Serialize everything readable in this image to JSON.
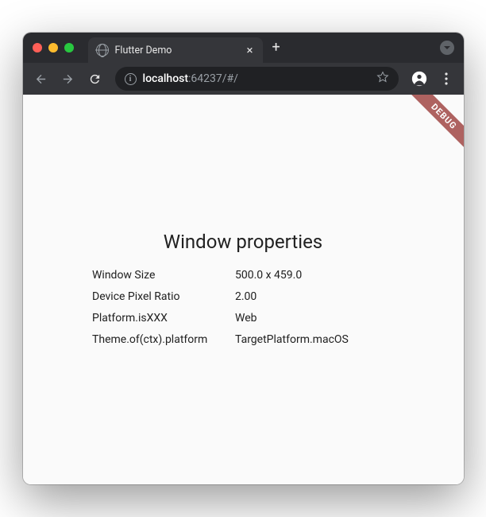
{
  "browser": {
    "tab": {
      "title": "Flutter Demo"
    },
    "address": {
      "host": "localhost",
      "rest": ":64237/#/"
    }
  },
  "app": {
    "debug_banner": "DEBUG",
    "title": "Window properties",
    "rows": [
      {
        "label": "Window Size",
        "value": "500.0 x 459.0"
      },
      {
        "label": "Device Pixel Ratio",
        "value": "2.00"
      },
      {
        "label": "Platform.isXXX",
        "value": "Web"
      },
      {
        "label": "Theme.of(ctx).platform",
        "value": "TargetPlatform.macOS"
      }
    ]
  }
}
